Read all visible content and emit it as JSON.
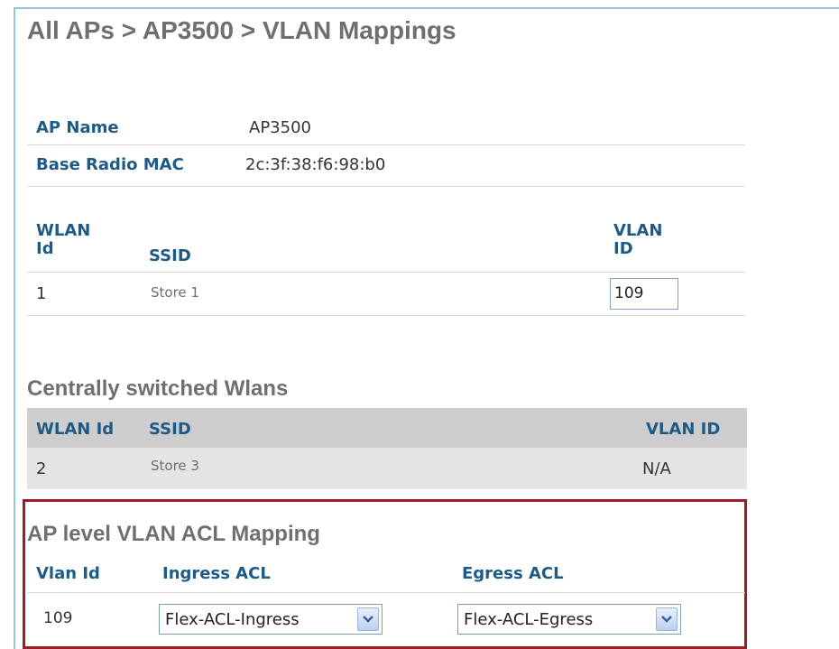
{
  "breadcrumb": "All APs > AP3500 > VLAN Mappings",
  "ap_info": {
    "ap_name_label": "AP Name",
    "ap_name_value": "AP3500",
    "base_mac_label": "Base Radio MAC",
    "base_mac_value": "2c:3f:38:f6:98:b0"
  },
  "wlan_table": {
    "col_wlan_line1": "WLAN",
    "col_wlan_line2": "Id",
    "col_ssid": "SSID",
    "col_vlan_line1": "VLAN",
    "col_vlan_line2": "ID",
    "rows": [
      {
        "wlan_id": "1",
        "ssid": "Store 1",
        "vlan_id": "109"
      }
    ]
  },
  "central": {
    "title": "Centrally switched Wlans",
    "col_wlan": "WLAN Id",
    "col_ssid": "SSID",
    "col_vlan": "VLAN ID",
    "rows": [
      {
        "wlan_id": "2",
        "ssid": "Store 3",
        "vlan_id": "N/A"
      }
    ]
  },
  "acl": {
    "title": "AP level VLAN ACL Mapping",
    "col_vlan": "Vlan Id",
    "col_ingress": "Ingress ACL",
    "col_egress": "Egress ACL",
    "rows": [
      {
        "vlan_id": "109",
        "ingress": "Flex-ACL-Ingress",
        "egress": "Flex-ACL-Egress"
      }
    ]
  },
  "colors": {
    "label_blue": "#1d5b86",
    "frame_border": "#8fc6d8",
    "acl_box_border": "#9b1d2a",
    "central_header_bg": "#cdcdcd"
  },
  "icons": {
    "select_arrow": "chevron-down-icon"
  }
}
